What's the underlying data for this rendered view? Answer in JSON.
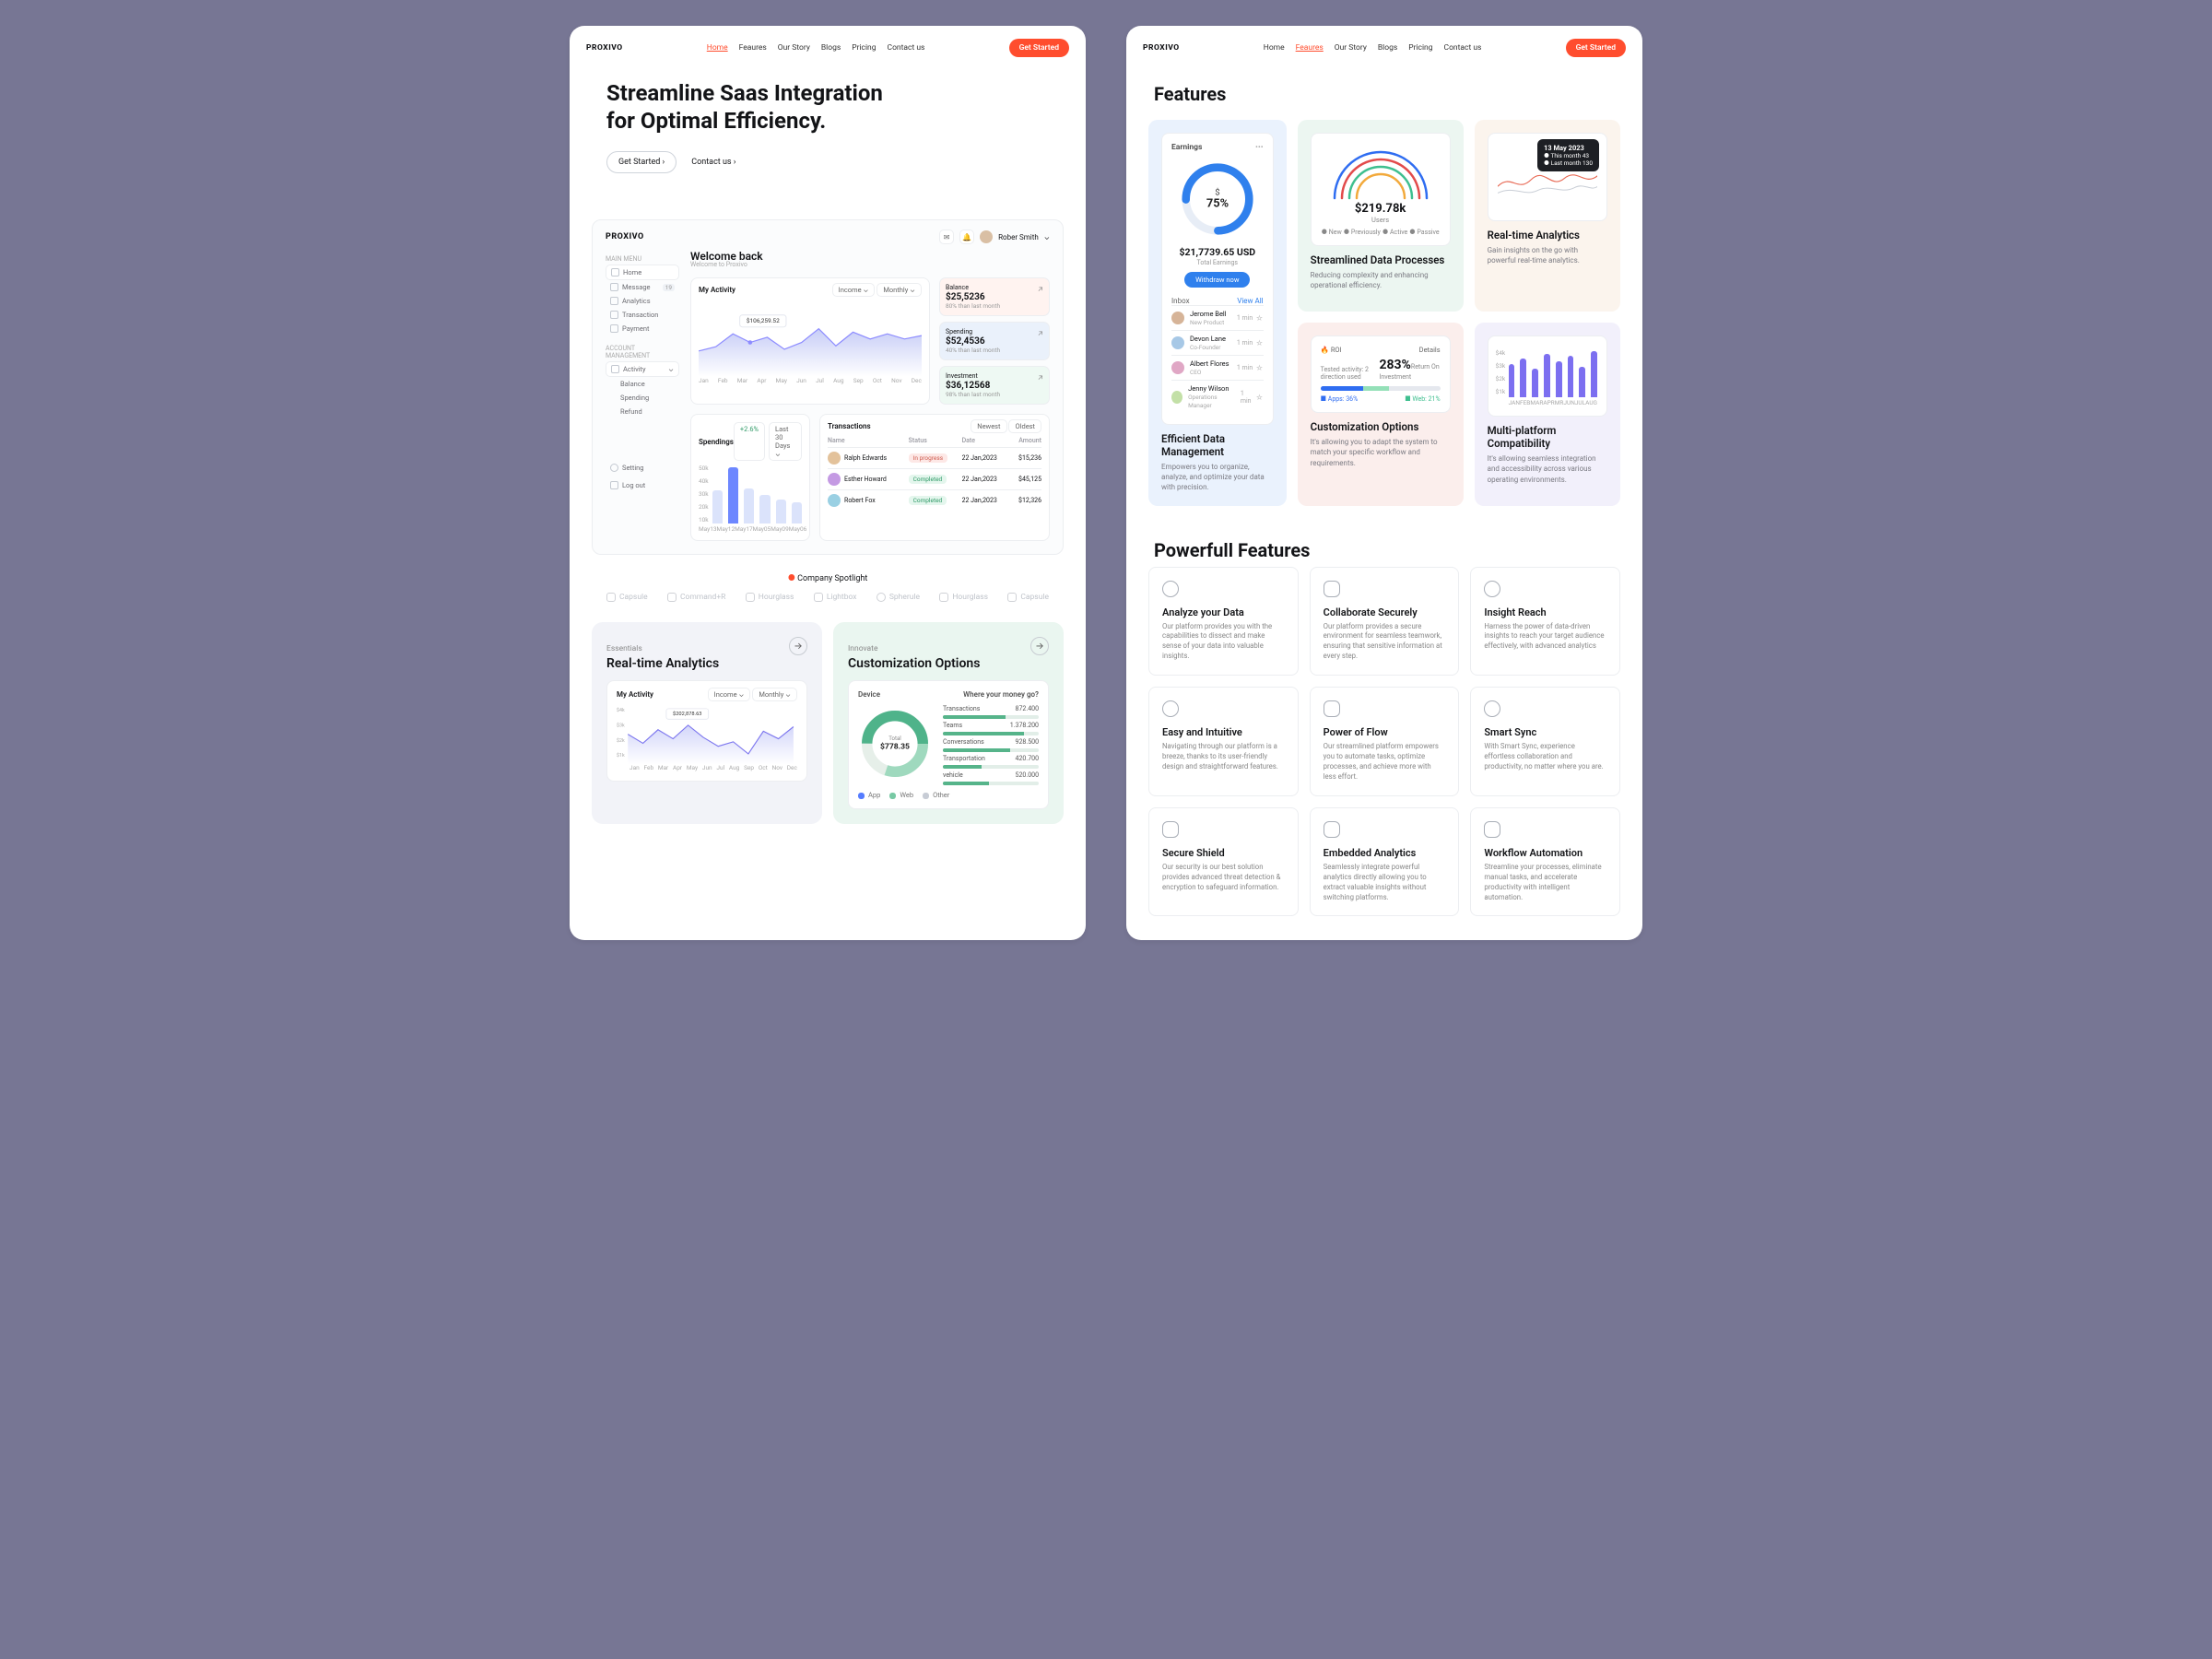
{
  "brand": "PROXIVO",
  "nav": {
    "home": "Home",
    "features": "Feaures",
    "story": "Our Story",
    "blogs": "Blogs",
    "pricing": "Pricing",
    "contact": "Contact us",
    "cta": "Get Started"
  },
  "hero": {
    "line1": "Streamline Saas Integration",
    "line2": "for Optimal Efficiency.",
    "cta": "Get Started  ›",
    "link": "Contact us  ›"
  },
  "dashboard": {
    "user": "Rober Smith",
    "mainmenu": "MAIN MENU",
    "acctmgmt": "ACCOUNT MANAGEMENT",
    "items": {
      "home": "Home",
      "message": "Message",
      "messageBadge": "19",
      "analytics": "Analytics",
      "transaction": "Transaction",
      "payment": "Payment"
    },
    "acct": {
      "activity": "Activity",
      "balance": "Balance",
      "spending": "Spending",
      "refund": "Refund"
    },
    "foot": {
      "setting": "Setting",
      "logout": "Log out"
    },
    "welcome": "Welcome back",
    "welcomeSub": "Welcome to Proxivo",
    "activity": {
      "title": "My Activity",
      "income": "Income",
      "monthly": "Monthly",
      "tooltip": "$106,259.52",
      "xlabels": [
        "Jan",
        "Feb",
        "Mar",
        "Apr",
        "May",
        "Jun",
        "Jul",
        "Aug",
        "Sep",
        "Oct",
        "Nov",
        "Dec"
      ]
    },
    "kpi": {
      "balance": {
        "label": "Balance",
        "value": "$25,5236",
        "sub": "80% than last month"
      },
      "spending": {
        "label": "Spending",
        "value": "$52,4536",
        "sub": "40% than last month"
      },
      "invest": {
        "label": "Investment",
        "value": "$36,12568",
        "sub": "98% than last month"
      }
    },
    "spend": {
      "title": "Spendings",
      "delta": "+2.6%",
      "filter": "Last 30 Days",
      "xlabels": [
        "May13",
        "May12",
        "May17",
        "May05",
        "May09",
        "May06"
      ]
    },
    "trans": {
      "title": "Transactions",
      "newest": "Newest",
      "oldest": "Oldest",
      "cols": {
        "name": "Name",
        "status": "Status",
        "date": "Date",
        "amount": "Amount"
      },
      "rows": [
        {
          "name": "Ralph Edwards",
          "status": "In progress",
          "date": "22 Jan,2023",
          "amount": "$15,236"
        },
        {
          "name": "Esther Howard",
          "status": "Completed",
          "date": "22 Jan,2023",
          "amount": "$45,125"
        },
        {
          "name": "Robert Fox",
          "status": "Completed",
          "date": "22 Jan,2023",
          "amount": "$12,326"
        }
      ]
    }
  },
  "spotlight": "Company Spotlight",
  "logos": [
    "Capsule",
    "Command+R",
    "Hourglass",
    "Lightbox",
    "Spherule",
    "Hourglass",
    "Capsule"
  ],
  "mod1": {
    "tag": "Essentials",
    "title": "Real-time Analytics",
    "activity": "My Activity",
    "income": "Income",
    "monthly": "Monthly",
    "tooltip": "$202,878.63",
    "xlabels": [
      "Jan",
      "Feb",
      "Mar",
      "Apr",
      "May",
      "Jun",
      "Jul",
      "Aug",
      "Sep",
      "Oct",
      "Nov",
      "Dec"
    ]
  },
  "mod2": {
    "tag": "Innovate",
    "title": "Customization Options",
    "device": "Device",
    "where": "Where your money go?",
    "total": "Total",
    "amount": "$778.35",
    "rows": [
      {
        "label": "Transactions",
        "value": "872.400"
      },
      {
        "label": "Teams",
        "value": "1.378.200"
      },
      {
        "label": "Conversations",
        "value": "928.500"
      },
      {
        "label": "Transportation",
        "value": "420.700"
      },
      {
        "label": "vehicle",
        "value": "520.000"
      }
    ],
    "legend": {
      "app": "App",
      "web": "Web",
      "other": "Other"
    }
  },
  "right": {
    "features": "Features",
    "cards": {
      "earn": {
        "title": "Efficient Data Management",
        "desc": "Empowers you to organize, analyze, and optimize your data with precision.",
        "head": "Earnings",
        "percent": "75%",
        "currency": "$",
        "amount": "$21,7739.65 USD",
        "sub": "Total Earnings",
        "cta": "Withdraw now",
        "inboxTitle": "Inbox",
        "viewAll": "View All",
        "inbox": [
          {
            "name": "Jerome Bell",
            "role": "New Product",
            "meta": "1 min"
          },
          {
            "name": "Devon Lane",
            "role": "Co-Founder",
            "meta": "1 min"
          },
          {
            "name": "Albert Flores",
            "role": "CEO",
            "meta": "1 min"
          },
          {
            "name": "Jenny Wilson",
            "role": "Operations Manager",
            "meta": "1 min"
          }
        ]
      },
      "stream": {
        "title": "Streamlined Data Processes",
        "desc": "Reducing complexity and enhancing operational efficiency.",
        "value": "$219.78k",
        "sub": "Users",
        "legend": [
          "New",
          "Previously",
          "Active",
          "Passive"
        ]
      },
      "realtime": {
        "title": "Real-time Analytics",
        "desc": "Gain insights on the go with powerful real-time analytics.",
        "tooltip": {
          "date": "13 May 2023",
          "a": "This month",
          "av": "43",
          "b": "Last month",
          "bv": "130"
        }
      },
      "cust": {
        "title": "Customization Options",
        "desc": "It's allowing you to  adapt the system to match your specific workflow and requirements.",
        "roiLabel": "ROI",
        "details": "Details",
        "tested": "Tested activity: 2 direction used",
        "value": "283%",
        "sub": "Return On Investment",
        "apps": "Apps: 36%",
        "web": "Web: 21%"
      },
      "multi": {
        "title": "Multi-platform Compatibility",
        "desc": "It's allowing seamless integration and accessibility across various operating environments.",
        "ylabels": [
          "$4k",
          "$3k",
          "$2k",
          "$1k"
        ],
        "xlabels": [
          "JAN",
          "FEB",
          "MAR",
          "APR",
          "MR",
          "JUN",
          "JUL",
          "AUG"
        ]
      }
    },
    "powerful": "Powerfull Features",
    "pf": [
      {
        "title": "Analyze your Data",
        "desc": "Our platform provides you with the capabilities to dissect and make sense of your data into valuable insights."
      },
      {
        "title": "Collaborate Securely",
        "desc": "Our platform provides a secure environment for seamless teamwork, ensuring that sensitive information at every step."
      },
      {
        "title": "Insight Reach",
        "desc": "Harness the power of data-driven insights to reach your target audience effectively, with advanced analytics"
      },
      {
        "title": "Easy and Intuitive",
        "desc": "Navigating through our platform is a breeze, thanks to its user-friendly design and straightforward features."
      },
      {
        "title": "Power of Flow",
        "desc": "Our streamlined platform empowers you to automate tasks, optimize processes, and achieve more with less effort."
      },
      {
        "title": "Smart Sync",
        "desc": "With Smart Sync, experience effortless collaboration and productivity, no matter where you are."
      },
      {
        "title": "Secure Shield",
        "desc": "Our security is our best solution provides advanced threat detection & encryption to safeguard information."
      },
      {
        "title": "Embedded Analytics",
        "desc": "Seamlessly integrate powerful analytics directly allowing you to extract valuable insights without switching platforms."
      },
      {
        "title": "Workflow Automation",
        "desc": "Streamline your processes, eliminate manual tasks, and accelerate productivity with intelligent automation."
      }
    ]
  },
  "chart_data": [
    {
      "type": "area",
      "name": "My Activity (hero)",
      "x": [
        "Jan",
        "Feb",
        "Mar",
        "Apr",
        "May",
        "Jun",
        "Jul",
        "Aug",
        "Sep",
        "Oct",
        "Nov",
        "Dec"
      ],
      "values": [
        22,
        26,
        38,
        30,
        34,
        24,
        28,
        40,
        26,
        38,
        34,
        32
      ],
      "ylim": [
        0,
        50
      ],
      "tooltip": 106259.52
    },
    {
      "type": "bar",
      "name": "Spendings",
      "categories": [
        "May13",
        "May12",
        "May17",
        "May05",
        "May09",
        "May06"
      ],
      "values": [
        28,
        48,
        30,
        24,
        20,
        18
      ],
      "ylim": [
        0,
        50
      ],
      "unit": "k"
    },
    {
      "type": "area",
      "name": "Real-time Analytics module",
      "x": [
        "Jan",
        "Feb",
        "Mar",
        "Apr",
        "May",
        "Jun",
        "Jul",
        "Aug",
        "Sep",
        "Oct",
        "Nov",
        "Dec"
      ],
      "values": [
        2.4,
        1.8,
        2.6,
        2.0,
        2.8,
        2.2,
        1.6,
        1.9,
        1.2,
        2.5,
        2.0,
        2.7
      ],
      "ylim": [
        0,
        4
      ],
      "unit": "k",
      "tooltip": 202878.63
    },
    {
      "type": "pie",
      "name": "Device donut",
      "slices": [
        {
          "name": "App",
          "value": 50
        },
        {
          "name": "Web",
          "value": 30
        },
        {
          "name": "Other",
          "value": 20
        }
      ],
      "centerTotal": 778.35
    },
    {
      "type": "pie",
      "name": "Earnings donut",
      "slices": [
        {
          "name": "earned",
          "value": 75
        },
        {
          "name": "remaining",
          "value": 25
        }
      ]
    },
    {
      "type": "line",
      "name": "Streamlined arcs (gauge)",
      "series": [
        {
          "name": "New",
          "value": 85
        },
        {
          "name": "Previously",
          "value": 70
        },
        {
          "name": "Active",
          "value": 55
        },
        {
          "name": "Passive",
          "value": 40
        }
      ],
      "headline": "$219.78k Users"
    },
    {
      "type": "bar",
      "name": "ROI stacked",
      "series": [
        {
          "name": "Apps",
          "value": 36
        },
        {
          "name": "Web",
          "value": 21
        }
      ],
      "headline": "283% ROI"
    },
    {
      "type": "bar",
      "name": "Multi-platform bars",
      "categories": [
        "JAN",
        "FEB",
        "MAR",
        "APR",
        "MR",
        "JUN",
        "JUL",
        "AUG"
      ],
      "values": [
        2.6,
        3.0,
        2.2,
        3.4,
        2.8,
        3.2,
        2.4,
        3.6
      ],
      "ylim": [
        0,
        4
      ],
      "unit": "$k"
    }
  ]
}
